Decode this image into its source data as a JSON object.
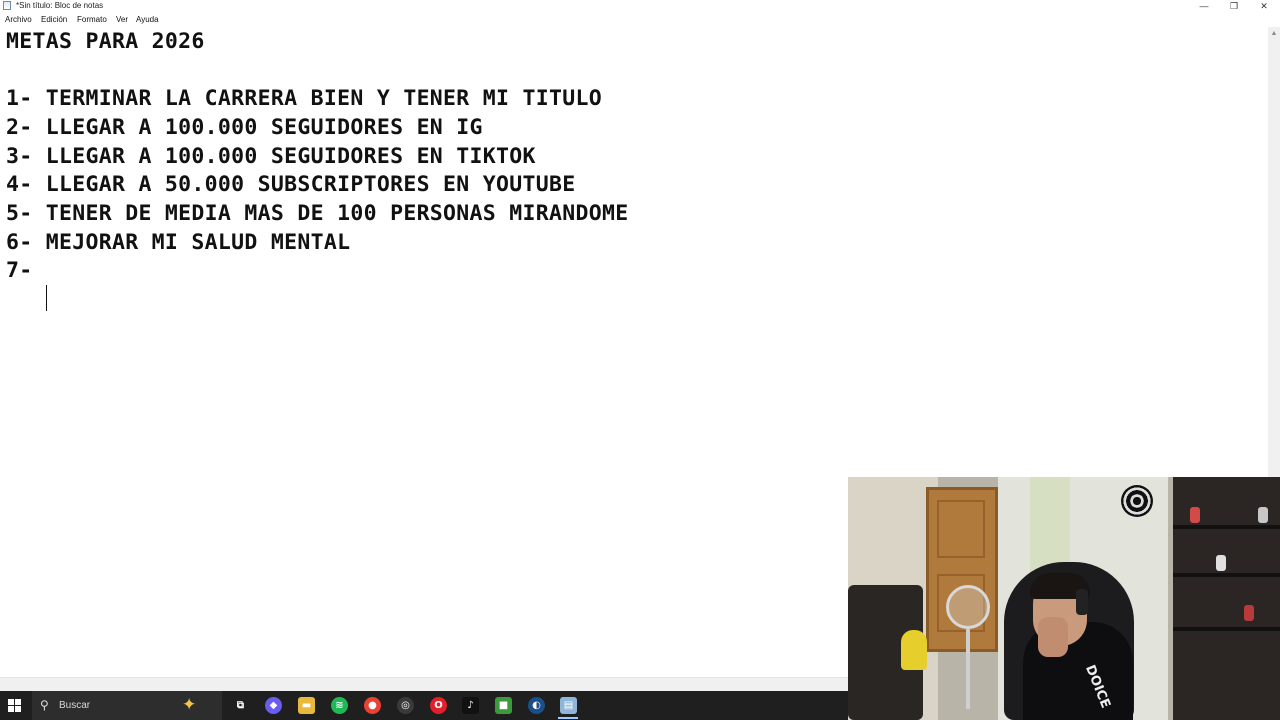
{
  "window": {
    "title": "*Sin título: Bloc de notas",
    "controls": {
      "minimize": "—",
      "restore": "❐",
      "close": "✕"
    }
  },
  "menu": [
    "Archivo",
    "Edición",
    "Formato",
    "Ver",
    "Ayuda"
  ],
  "document": {
    "lines": [
      "METAS PARA 2026",
      "",
      "1- TERMINAR LA CARRERA BIEN Y TENER MI TITULO",
      "2- LLEGAR A 100.000 SEGUIDORES EN IG",
      "3- LLEGAR A 100.000 SEGUIDORES EN TIKTOK",
      "4- LLEGAR A 50.000 SUBSCRIPTORES EN YOUTUBE",
      "5- TENER DE MEDIA MAS DE 100 PERSONAS MIRANDOME",
      "6- MEJORAR MI SALUD MENTAL",
      "7- "
    ]
  },
  "webcam": {
    "shirt_logo": "DOICE"
  },
  "taskbar": {
    "search_placeholder": "Buscar",
    "apps": [
      {
        "name": "task-view",
        "glyph": "⧉",
        "color": "#1f1f1f"
      },
      {
        "name": "copilot",
        "glyph": "◆",
        "color": "#6a5cf0"
      },
      {
        "name": "file-explorer",
        "glyph": "▬",
        "color": "#e8b93a"
      },
      {
        "name": "spotify",
        "glyph": "≋",
        "color": "#1db954"
      },
      {
        "name": "chrome",
        "glyph": "●",
        "color": "#e94235"
      },
      {
        "name": "obs",
        "glyph": "◎",
        "color": "#3a3a3a"
      },
      {
        "name": "opera",
        "glyph": "O",
        "color": "#e0202a"
      },
      {
        "name": "tiktok",
        "glyph": "♪",
        "color": "#111111"
      },
      {
        "name": "minecraft",
        "glyph": "■",
        "color": "#3c9a3c"
      },
      {
        "name": "steam",
        "glyph": "◐",
        "color": "#1b4f8a"
      },
      {
        "name": "notepad",
        "glyph": "▤",
        "color": "#8fb6d8"
      }
    ]
  }
}
